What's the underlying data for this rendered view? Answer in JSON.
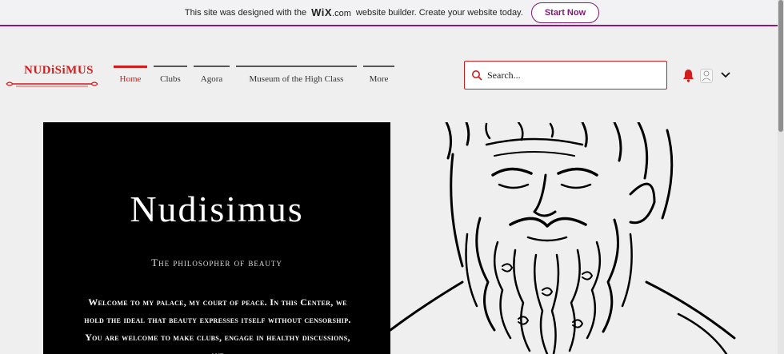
{
  "banner": {
    "prefix": "This site was designed with the",
    "brand": "WiX",
    "brand_suffix": ".com",
    "suffix": "website builder. Create your website today.",
    "cta": "Start Now"
  },
  "site": {
    "logo_text": "NUDiSiMUS"
  },
  "nav": {
    "items": [
      {
        "label": "Home"
      },
      {
        "label": "Clubs"
      },
      {
        "label": "Agora"
      },
      {
        "label": "Museum of the High Class"
      },
      {
        "label": "More"
      }
    ]
  },
  "search": {
    "placeholder": "Search..."
  },
  "icons": {
    "accent": "#d41c1c",
    "banner_accent": "#7e1a73"
  },
  "hero": {
    "title": "Nudisimus",
    "subtitle": "The philosopher of beauty",
    "body": "Welcome to my palace, my court of peace. In this Center, we hold the ideal that beauty expresses itself without censorship. You are welcome to make clubs, engage in healthy discussions, and"
  }
}
